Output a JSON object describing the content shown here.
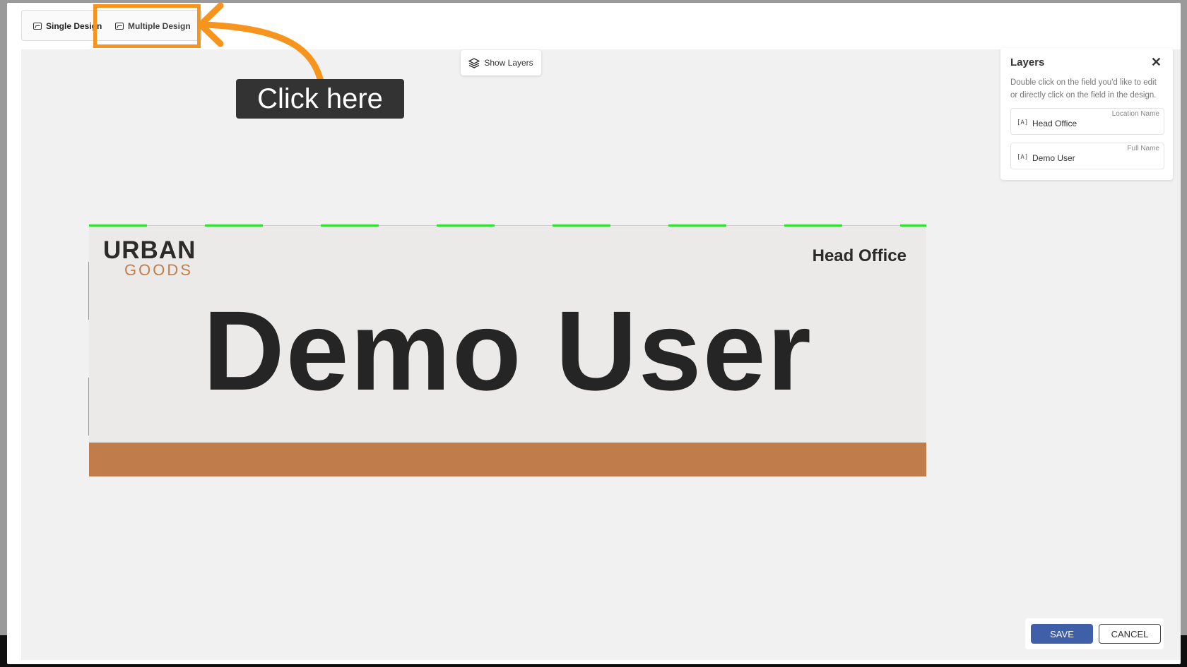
{
  "tabs": {
    "single_label": "Single Design",
    "multiple_label": "Multiple Design"
  },
  "toolbar": {
    "show_layers_label": "Show Layers"
  },
  "annotation": {
    "tooltip_text": "Click here",
    "accent_color": "#f7941d"
  },
  "badge": {
    "logo_line1": "URBAN",
    "logo_line2": "GOODS",
    "location": "Head Office",
    "name": "Demo User",
    "bar_color": "#c17c4b"
  },
  "layers_panel": {
    "title": "Layers",
    "description": "Double click on the field you'd like to edit or directly click on the field in the design.",
    "items": [
      {
        "label": "Location Name",
        "value": "Head Office",
        "icon": "text-field-icon"
      },
      {
        "label": "Full Name",
        "value": "Demo User",
        "icon": "text-field-icon"
      }
    ]
  },
  "footer": {
    "save_label": "SAVE",
    "cancel_label": "CANCEL",
    "save_color": "#3f5fa8"
  }
}
